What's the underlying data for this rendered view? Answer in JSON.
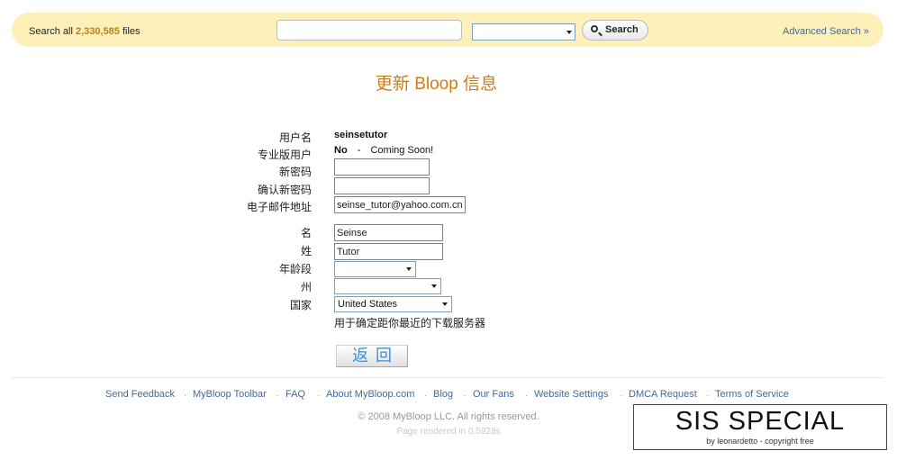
{
  "header": {
    "search_prefix": "Search all",
    "file_count": "2,330,585",
    "search_suffix": "files",
    "search_query": "",
    "search_category": "",
    "search_button": "Search",
    "advanced_search": "Advanced Search »"
  },
  "page": {
    "title": "更新 Bloop 信息"
  },
  "form": {
    "username_label": "用户名",
    "username_value": "seinsetutor",
    "pro_label": "专业版用户",
    "pro_value": "No",
    "pro_dash": "-",
    "pro_note": "Coming Soon!",
    "new_password_label": "新密码",
    "new_password_value": "",
    "confirm_password_label": "确认新密码",
    "confirm_password_value": "",
    "email_label": "电子邮件地址",
    "email_value": "seinse_tutor@yahoo.com.cn",
    "first_name_label": "名",
    "first_name_value": "Seinse",
    "last_name_label": "姓",
    "last_name_value": "Tutor",
    "age_label": "年龄段",
    "age_value": "",
    "state_label": "州",
    "state_value": "",
    "country_label": "国家",
    "country_value": "United States",
    "country_note": "用于确定距你最近的下载服务器",
    "back_button": "返回"
  },
  "footer": {
    "links": [
      "Send Feedback",
      "MyBloop Toolbar",
      "FAQ",
      "About MyBloop.com",
      "Blog",
      "Our Fans",
      "Website Settings",
      "DMCA Request",
      "Terms of Service"
    ],
    "copyright": "© 2008 MyBloop LLC. All rights reserved.",
    "rendered": "Page rendered in 0.5928s"
  },
  "watermark": {
    "title": "SIS SPECIAL",
    "subtitle": "by leonardetto - copyright free"
  },
  "colors": {
    "search_bar_bg": "#fdf0b9",
    "accent_orange": "#d07c14",
    "link_blue": "#44699c",
    "button_text_blue": "#3e8fd4"
  }
}
